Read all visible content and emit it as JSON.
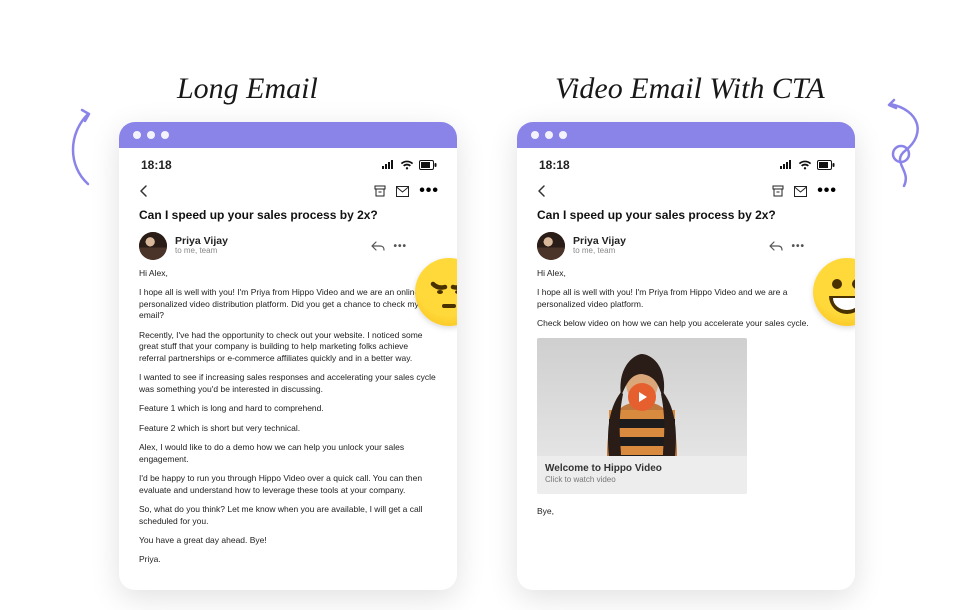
{
  "labels": {
    "left": "Long Email",
    "right": "Video Email With CTA"
  },
  "common": {
    "time": "18:18",
    "subject": "Can I speed up your sales process by 2x?",
    "sender": {
      "name": "Priya Vijay",
      "to": "to me, team"
    },
    "reply_icon": "reply-icon",
    "more_icon": "…"
  },
  "left_email": {
    "paragraphs": [
      "Hi Alex,",
      "I hope all is well with you! I'm Priya from Hippo Video and we are an online personalized video distribution platform. Did you get a chance to check my last email?",
      "Recently, I've had the opportunity to check out your website. I noticed some great stuff that your company is building to help marketing folks achieve referral partnerships or e-commerce affiliates quickly and in a better way.",
      "I wanted to see if increasing sales responses and accelerating your sales cycle was something you'd be interested in discussing.",
      "Feature 1 which is long and hard to comprehend.",
      "Feature 2 which is short but very technical.",
      "Alex, I would like to do a demo how we can help you unlock your sales engagement.",
      "I'd be happy to run you through Hippo Video over a quick call. You can then evaluate and understand how to leverage these tools at your company.",
      "So, what do you think? Let me know when you are available, I will get a call scheduled for you.",
      "You have a great day ahead. Bye!",
      "Priya."
    ]
  },
  "right_email": {
    "intro": [
      "Hi Alex,",
      "I hope all is well with you! I'm Priya from Hippo Video and we are a personalized video platform.",
      "Check below video on how we can help you accelerate your sales cycle."
    ],
    "video": {
      "title": "Welcome to Hippo Video",
      "sub": "Click to watch video"
    },
    "outro": [
      "Bye,"
    ]
  },
  "emoji": {
    "sad": "sad-face-emoji",
    "happy": "happy-face-emoji"
  },
  "colors": {
    "accent": "#8a84e9",
    "emoji": "#ffcf26",
    "play": "#e6602f"
  }
}
